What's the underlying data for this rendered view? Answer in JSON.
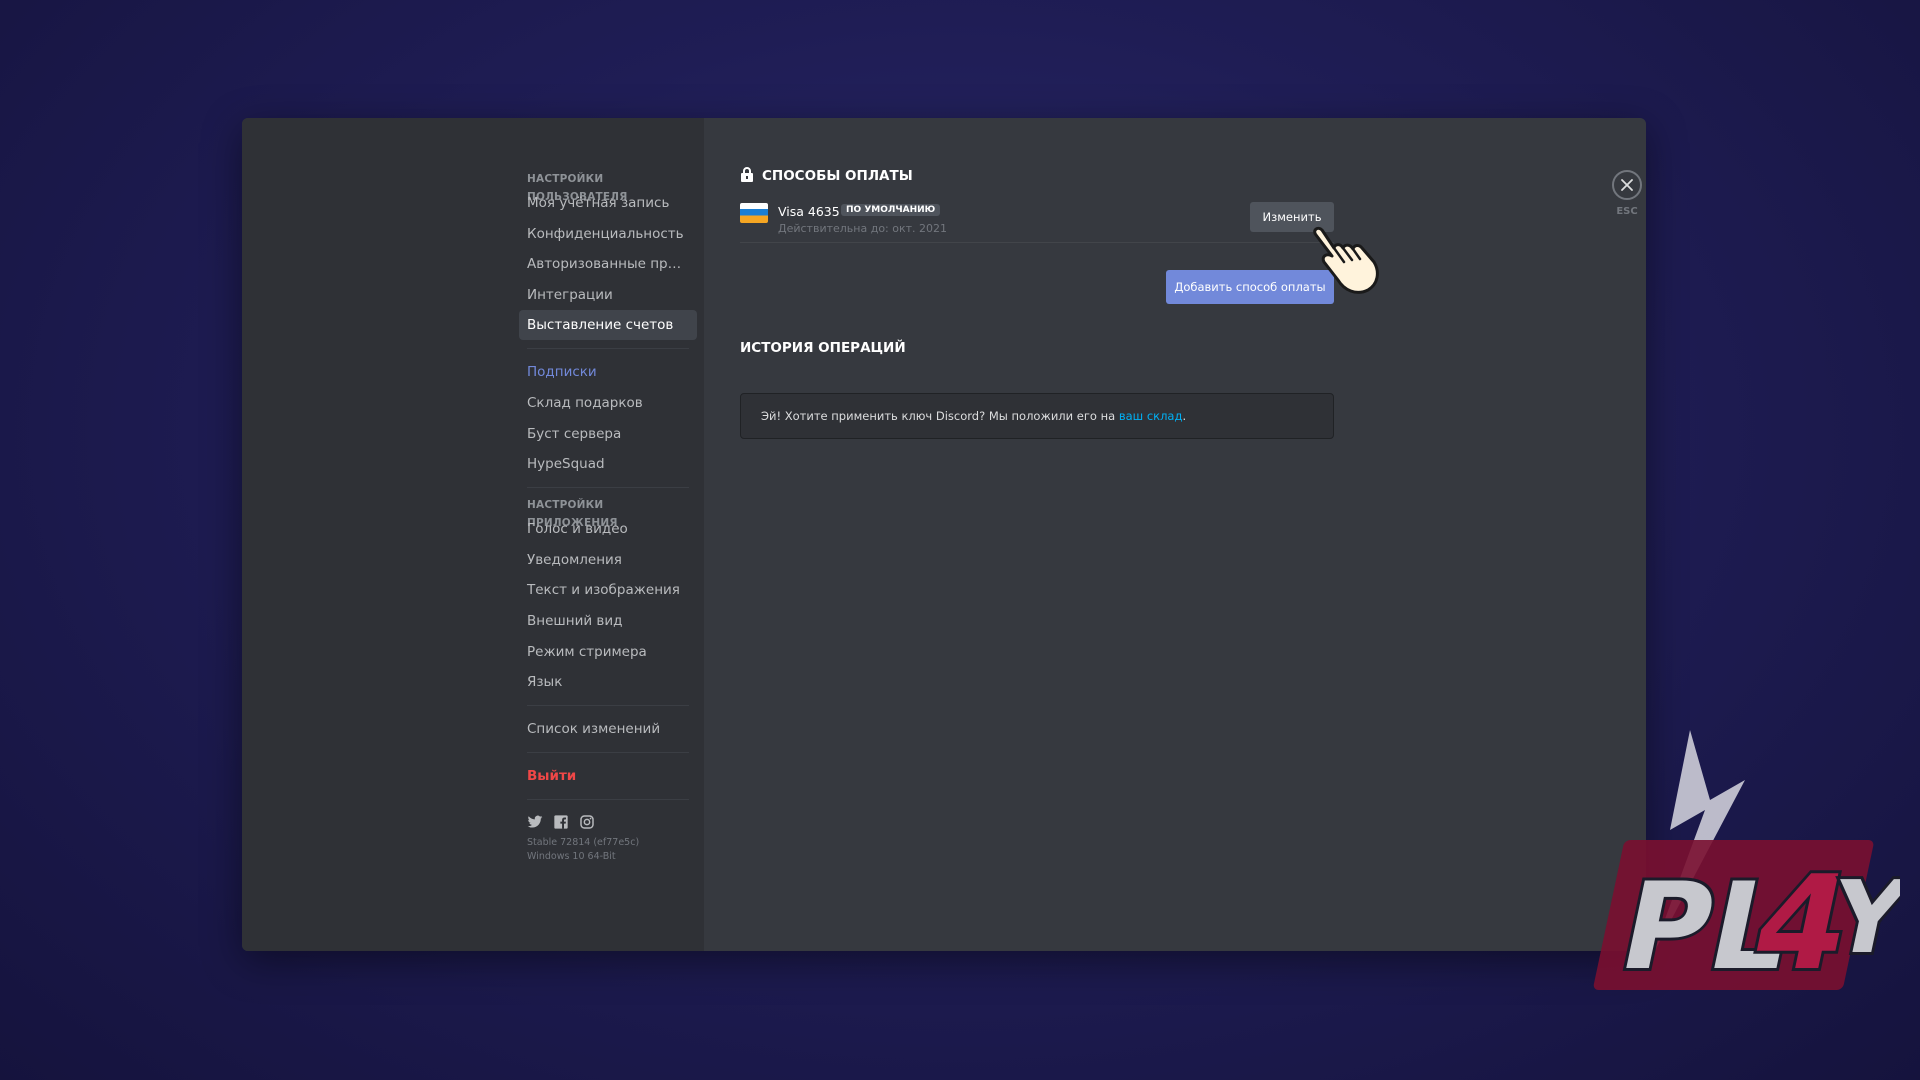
{
  "sidebar": {
    "user_settings_header": "НАСТРОЙКИ ПОЛЬЗОВАТЕЛЯ",
    "user_items": [
      "Моя учётная запись",
      "Конфиденциальность",
      "Авторизованные прил...",
      "Интеграции",
      "Выставление счетов"
    ],
    "selected_item": "Выставление счетов",
    "billing_items": [
      "Подписки",
      "Склад подарков",
      "Буст сервера",
      "HypeSquad"
    ],
    "app_settings_header": "НАСТРОЙКИ ПРИЛОЖЕНИЯ",
    "app_items": [
      "Голос и видео",
      "Уведомления",
      "Текст и изображения",
      "Внешний вид",
      "Режим стримера",
      "Язык"
    ],
    "changelog": "Список изменений",
    "logout": "Выйти",
    "social_icons": [
      "twitter-icon",
      "facebook-icon",
      "instagram-icon"
    ],
    "build_line1": "Stable 72814 (ef77e5c)",
    "build_line2": "Windows 10 64-Bit"
  },
  "main": {
    "payment_title": "СПОСОБЫ ОПЛАТЫ",
    "card": {
      "name": "Visa 4635",
      "badge": "ПО УМОЛЧАНИЮ",
      "expiry": "Действительна до: окт. 2021",
      "edit_label": "Изменить"
    },
    "add_payment_label": "Добавить способ оплаты",
    "history_title": "ИСТОРИЯ ОПЕРАЦИЙ",
    "notice_text": "Эй! Хотите применить ключ Discord? Мы положили его на",
    "notice_link": "ваш склад",
    "notice_end": "."
  },
  "close": {
    "esc_label": "ESC"
  },
  "overlay": {
    "logo_text": "PL4Y"
  },
  "colors": {
    "accent": "#7289da",
    "danger": "#f04747",
    "link": "#00b0f4",
    "window_bg": "#36393f",
    "sidebar_bg": "#2f3136"
  }
}
